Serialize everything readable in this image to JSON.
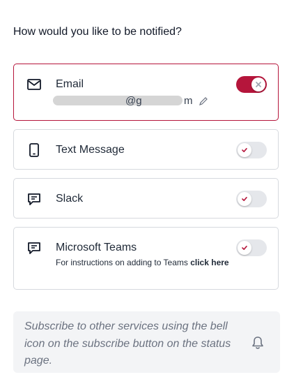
{
  "prompt": "How would you like to be notified?",
  "options": [
    {
      "label": "Email",
      "icon": "mail-icon",
      "enabled": true
    },
    {
      "label": "Text Message",
      "icon": "phone-icon",
      "enabled": false
    },
    {
      "label": "Slack",
      "icon": "chat-icon",
      "enabled": false
    },
    {
      "label": "Microsoft Teams",
      "icon": "chat-icon",
      "enabled": false
    }
  ],
  "email": {
    "visible_fragment": "@g",
    "visible_tail": "m",
    "edit_icon": "pencil-icon"
  },
  "teams": {
    "note": "For instructions on adding to Teams ",
    "link": "click here"
  },
  "info": {
    "text": "Subscribe to other services using the bell icon on the subscribe button on the status page.",
    "icon": "bell-icon"
  },
  "colors": {
    "accent": "#b5153b",
    "toggle_off": "#e5e7eb",
    "info_bg": "#f3f4f6"
  }
}
